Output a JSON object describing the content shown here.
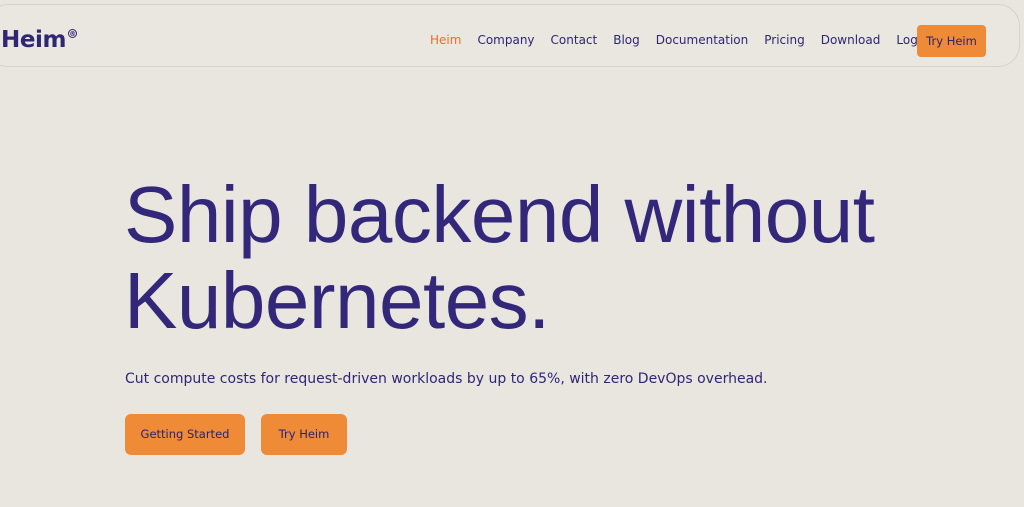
{
  "brand": {
    "name": "Heim",
    "reg_mark": "®"
  },
  "nav": {
    "items": [
      {
        "label": "Heim",
        "active": true
      },
      {
        "label": "Company",
        "active": false
      },
      {
        "label": "Contact",
        "active": false
      },
      {
        "label": "Blog",
        "active": false
      },
      {
        "label": "Documentation",
        "active": false
      },
      {
        "label": "Pricing",
        "active": false
      },
      {
        "label": "Download",
        "active": false
      },
      {
        "label": "Login",
        "active": false
      }
    ],
    "cta_label": "Try Heim"
  },
  "hero": {
    "title_line1": "Ship backend without",
    "title_line2": "Kubernetes.",
    "subtitle": "Cut compute costs for request-driven workloads by up to 65%, with zero DevOps overhead.",
    "primary_cta": "Getting Started",
    "secondary_cta": "Try Heim"
  },
  "colors": {
    "background": "#e8e6df",
    "brand_text": "#2f2674",
    "accent": "#ef8a36",
    "active_link": "#ec6d2a"
  }
}
